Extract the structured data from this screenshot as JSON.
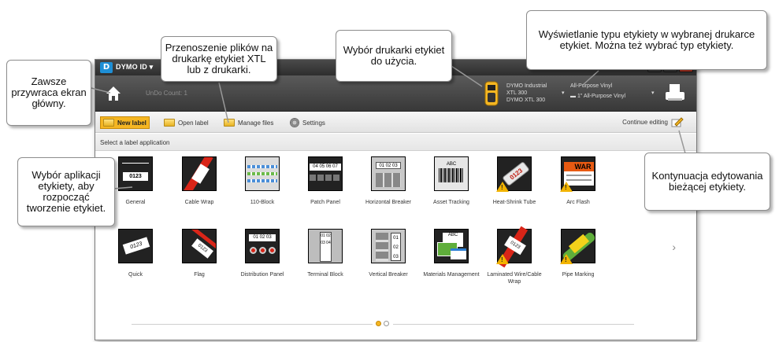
{
  "app": {
    "name": "DYMO ID",
    "logo_letter": "D"
  },
  "toolbar": {
    "undo_label": "UnDo Count: 1",
    "printer": {
      "line1": "DYMO Industrial",
      "line2": "XTL 300",
      "line3": "DYMO XTL 300"
    },
    "label_type": {
      "line1": "All-Purpose Vinyl",
      "line2": "1\" All-Purpose Vinyl"
    }
  },
  "menu": {
    "new_label": "New label",
    "open_label": "Open label",
    "manage_files": "Manage files",
    "settings": "Settings",
    "continue_editing": "Continue editing"
  },
  "section": {
    "title": "Select a label application"
  },
  "tiles": [
    {
      "label": "General",
      "thumb_text": "0123"
    },
    {
      "label": "Cable Wrap"
    },
    {
      "label": "110-Block"
    },
    {
      "label": "Patch Panel",
      "thumb_text": "04 05 06 07"
    },
    {
      "label": "Horizontal Breaker",
      "thumb_text": "01 02 03"
    },
    {
      "label": "Asset Tracking",
      "thumb_text": "ABC"
    },
    {
      "label": "Heat-Shrink Tube",
      "thumb_text": "0123",
      "warning": true
    },
    {
      "label": "Arc Flash",
      "thumb_text": "WAR",
      "warning": true
    },
    {
      "label": "Quick",
      "thumb_text": "0123"
    },
    {
      "label": "Flag",
      "thumb_text": "0123"
    },
    {
      "label": "Distribution Panel",
      "thumb_text": "01 02 03"
    },
    {
      "label": "Terminal Block",
      "thumb_text": "01 02 03 04"
    },
    {
      "label": "Vertical Breaker",
      "thumb_text": "01 02 03"
    },
    {
      "label": "Materials Management",
      "thumb_text": "ABC"
    },
    {
      "label": "Laminated Wire/Cable Wrap",
      "thumb_text": "0123",
      "warning": true
    },
    {
      "label": "Pipe Marking",
      "warning": true
    }
  ],
  "pager": {
    "pages": 2,
    "current": 1
  },
  "callouts": {
    "home": "Zawsze przywraca ekran główny.",
    "files": "Przenoszenie plików na drukarkę etykiet XTL lub z drukarki.",
    "printer": "Wybór drukarki etykiet do użycia.",
    "label_type": "Wyświetlanie typu etykiety w wybranej drukarce etykiet. Można też wybrać typ etykiety.",
    "application": "Wybór aplikacji etykiety, aby rozpocząć tworzenie etykiet.",
    "continue": "Kontynuacja edytowania bieżącej etykiety."
  },
  "colors": {
    "accent": "#f5b622",
    "titlebar": "#3a3a3a",
    "warning": "#f2b400",
    "arc_flash": "#e85a12"
  },
  "icons": {
    "home": "home-icon",
    "open": "folder-icon",
    "manage": "folder-transfer-icon",
    "settings": "gear-icon",
    "continue": "pencil-edit-icon",
    "print": "print-icon",
    "printer": "label-printer-icon",
    "next": "chevron-right-icon",
    "warning": "warning-triangle-icon"
  }
}
